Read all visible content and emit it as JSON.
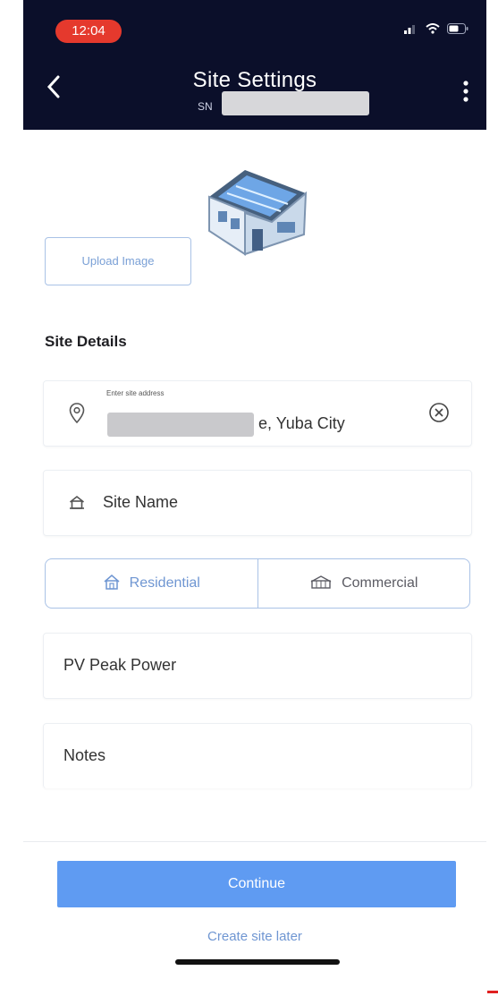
{
  "status_bar": {
    "time": "12:04"
  },
  "header": {
    "title": "Site Settings",
    "subtitle_prefix": "SN"
  },
  "upload": {
    "label": "Upload Image"
  },
  "section": {
    "title": "Site Details"
  },
  "address": {
    "label": "Enter site address",
    "value": "e, Yuba City"
  },
  "site_name": {
    "placeholder": "Site Name"
  },
  "site_type": {
    "options": [
      "Residential",
      "Commercial"
    ],
    "selected": "Residential"
  },
  "pv_peak_power": {
    "placeholder": "PV Peak Power"
  },
  "notes": {
    "placeholder": "Notes"
  },
  "actions": {
    "continue_label": "Continue",
    "later_label": "Create site later"
  },
  "colors": {
    "header_bg": "#0b0f2a",
    "accent": "#5f9bf2",
    "time_pill": "#e5392d"
  }
}
